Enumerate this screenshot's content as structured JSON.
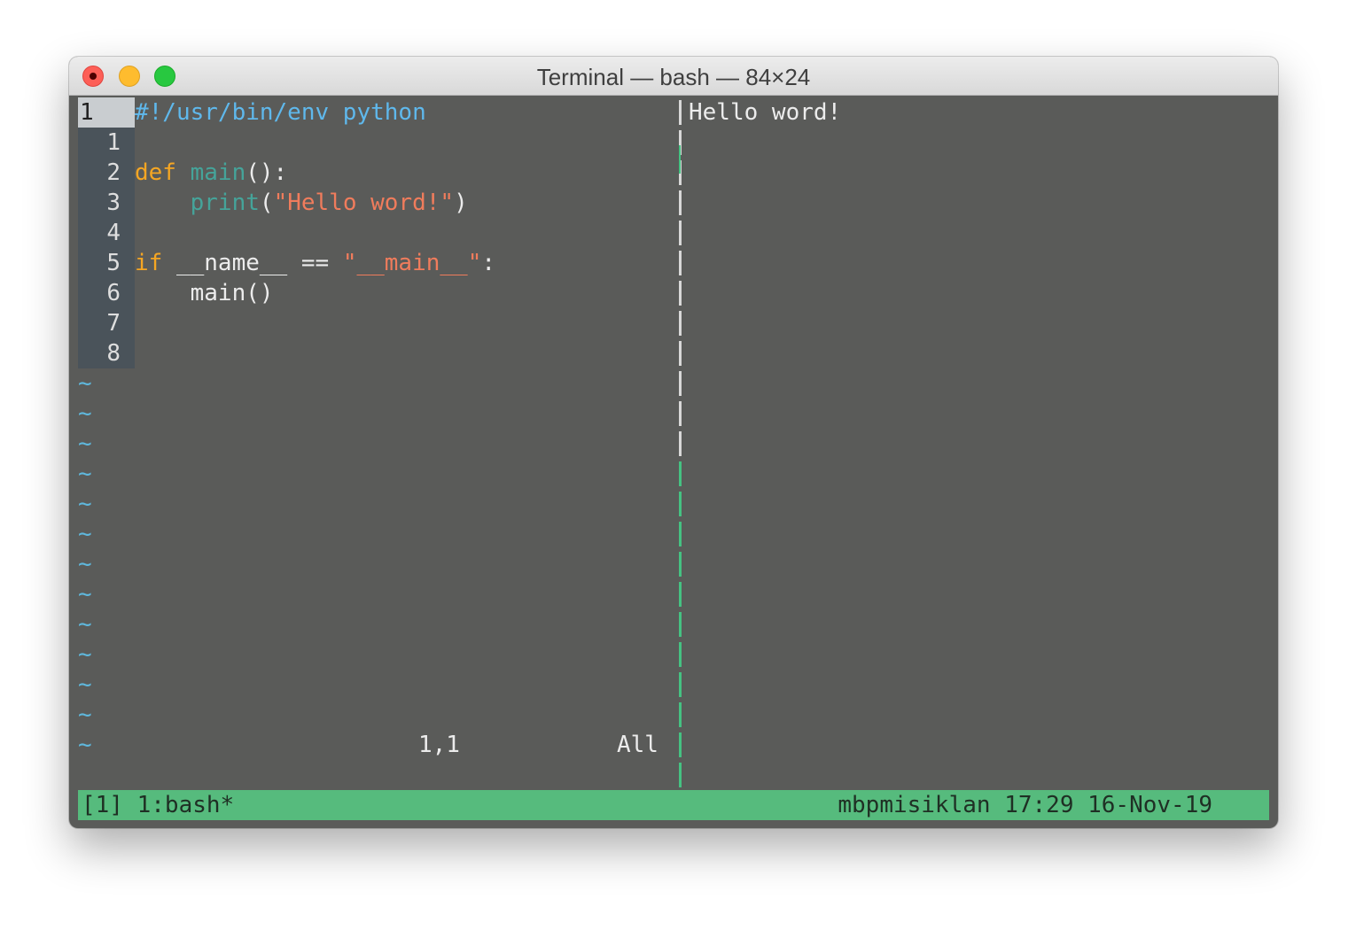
{
  "window": {
    "title": "Terminal — bash — 84×24"
  },
  "editor": {
    "current_line_number": "1",
    "lines": [
      {
        "num": "1",
        "tokens": [
          {
            "t": "",
            "c": "plain"
          }
        ]
      },
      {
        "num": "2",
        "tokens": [
          {
            "t": "def",
            "c": "keyword"
          },
          {
            "t": " ",
            "c": "plain"
          },
          {
            "t": "main",
            "c": "func"
          },
          {
            "t": "():",
            "c": "plain"
          }
        ]
      },
      {
        "num": "3",
        "tokens": [
          {
            "t": "    ",
            "c": "plain"
          },
          {
            "t": "print",
            "c": "func"
          },
          {
            "t": "(",
            "c": "plain"
          },
          {
            "t": "\"Hello word!\"",
            "c": "string"
          },
          {
            "t": ")",
            "c": "plain"
          }
        ]
      },
      {
        "num": "4",
        "tokens": [
          {
            "t": "",
            "c": "plain"
          }
        ]
      },
      {
        "num": "5",
        "tokens": [
          {
            "t": "if",
            "c": "keyword"
          },
          {
            "t": " __name__ == ",
            "c": "plain"
          },
          {
            "t": "\"__main__\"",
            "c": "string"
          },
          {
            "t": ":",
            "c": "plain"
          }
        ]
      },
      {
        "num": "6",
        "tokens": [
          {
            "t": "    main()",
            "c": "plain"
          }
        ]
      },
      {
        "num": "7",
        "tokens": [
          {
            "t": "",
            "c": "plain"
          }
        ]
      },
      {
        "num": "8",
        "tokens": [
          {
            "t": "",
            "c": "plain"
          }
        ]
      }
    ],
    "first_line": [
      {
        "t": "#!/usr/bin/env python",
        "c": "comment"
      }
    ],
    "empty_line_marker": "~",
    "empty_line_count": 13,
    "ruler_position": "1,1",
    "ruler_scroll": "All"
  },
  "right_pane": {
    "output": "Hello word!"
  },
  "status_bar": {
    "left": "[1] 1:bash*",
    "right": "mbpmisiklan 17:29 16-Nov-19"
  },
  "colors": {
    "terminal_bg": "#5a5b59",
    "status_bg": "#56bb7d",
    "gutter_bg": "#4a535a",
    "keyword": "#f5a623",
    "function": "#45a49a",
    "string": "#f07c5c",
    "comment": "#5fb8ec",
    "tilde": "#5fb8dd",
    "split_white": "#d8d8d8",
    "split_green": "#45c282"
  }
}
